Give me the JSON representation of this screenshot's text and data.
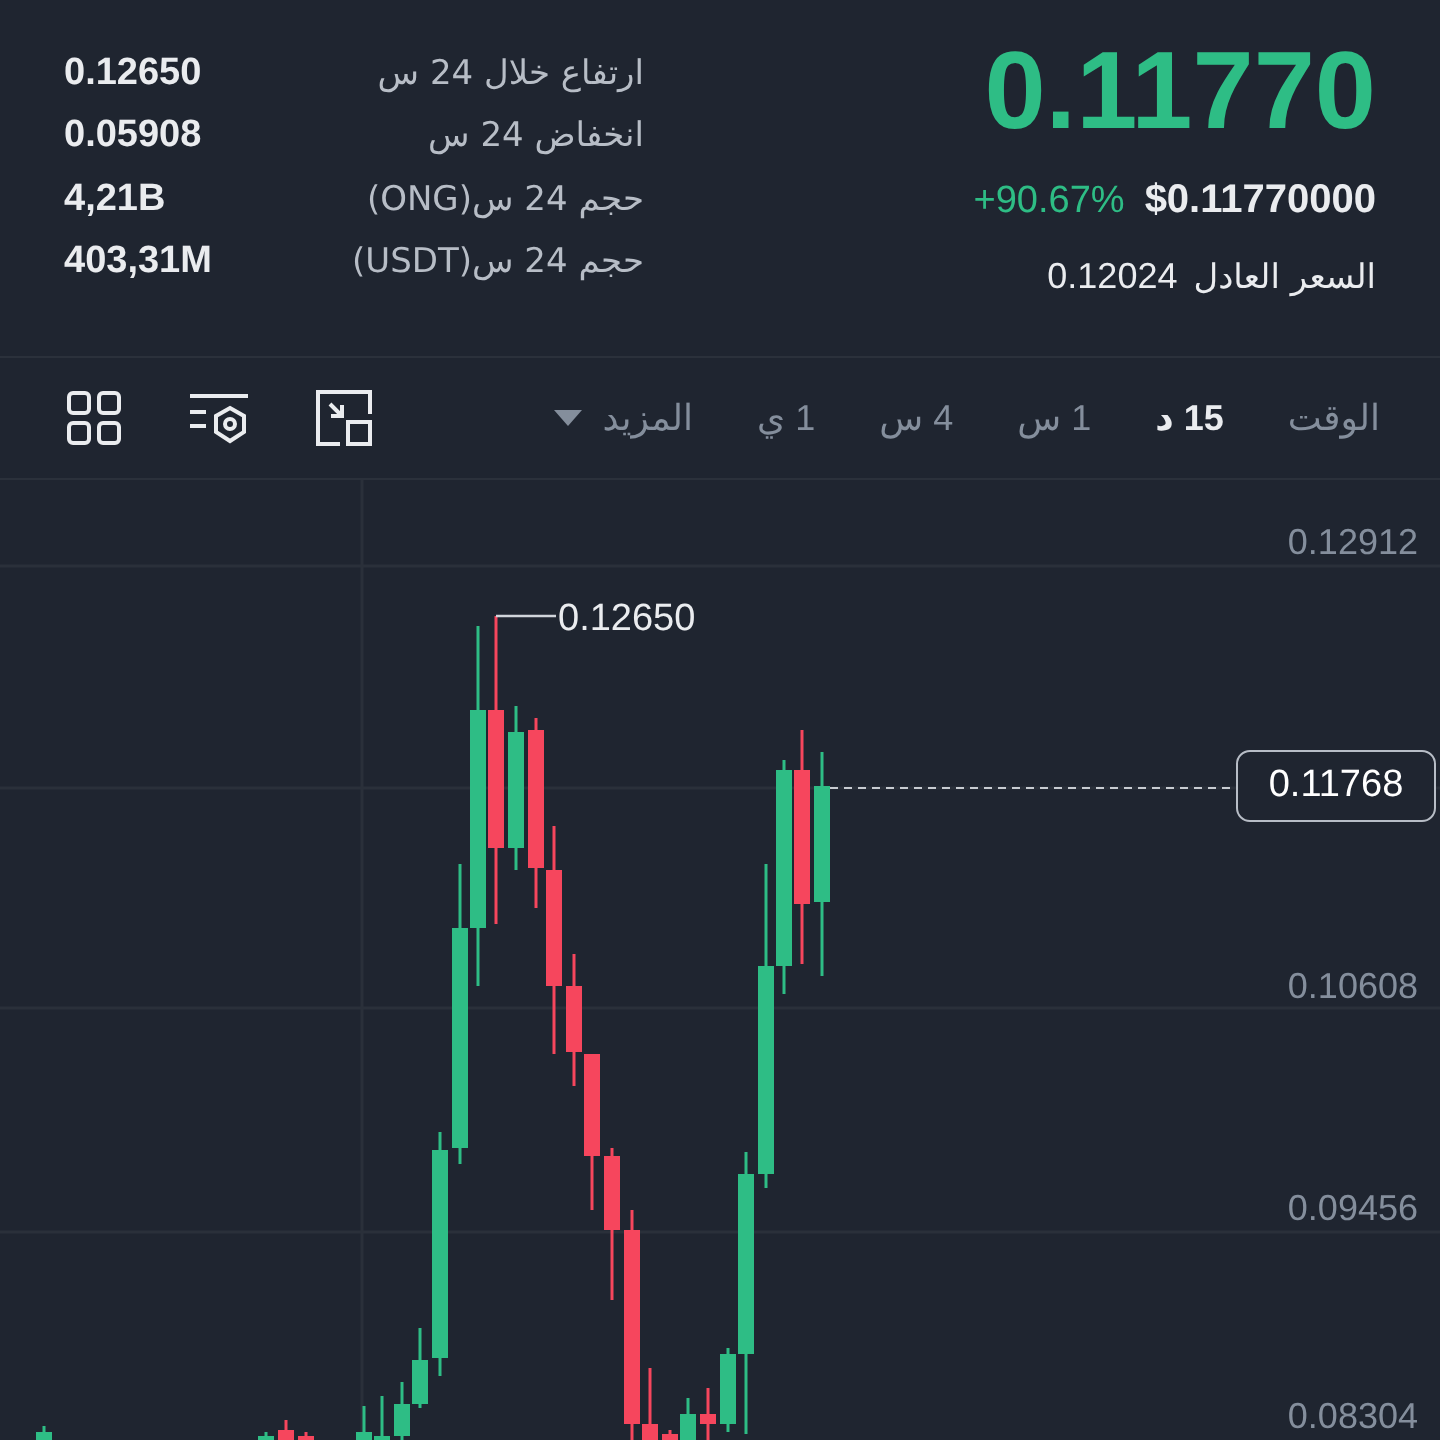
{
  "price_header": {
    "last_price": "0.11770",
    "change": "+90.67%",
    "usd_price": "$0.11770000",
    "fair_price": {
      "label": "السعر العادل",
      "value": "0.12024"
    }
  },
  "stats": [
    {
      "label": "ارتفاع خلال 24 س",
      "value": "0.12650"
    },
    {
      "label": "انخفاض 24 س",
      "value": "0.05908"
    },
    {
      "label": "حجم 24 س(ONG)",
      "value": "4,21B"
    },
    {
      "label": "حجم 24 س(USDT)",
      "value": "403,31M"
    }
  ],
  "toolbar": {
    "time_label": "الوقت",
    "intervals": [
      {
        "label": "15 د",
        "selected": true
      },
      {
        "label": "1 س",
        "selected": false
      },
      {
        "label": "4 س",
        "selected": false
      },
      {
        "label": "1 ي",
        "selected": false
      }
    ],
    "more": "المزيد"
  },
  "chart": {
    "price_ticks": [
      "0.12912",
      "0.10608",
      "0.09456",
      "0.08304"
    ],
    "last_price_tag": "0.11768",
    "high_label": "0.12650"
  }
}
